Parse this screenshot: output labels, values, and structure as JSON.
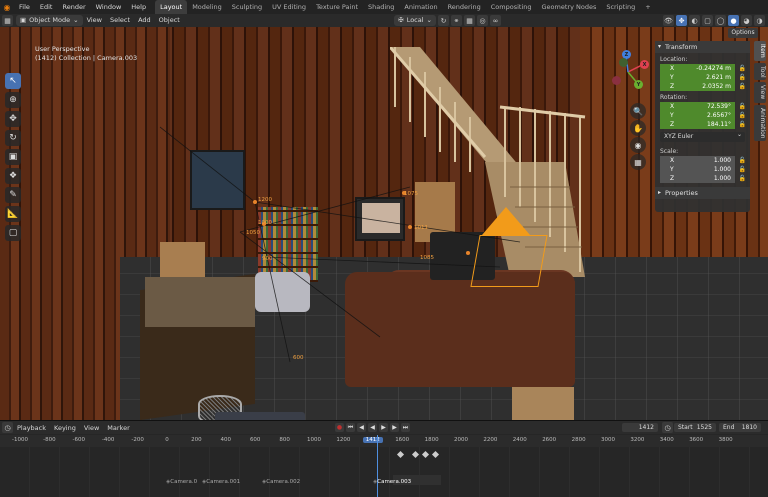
{
  "topbar": {
    "menus": [
      "File",
      "Edit",
      "Render",
      "Window",
      "Help"
    ],
    "workspaces": [
      "Layout",
      "Modeling",
      "Sculpting",
      "UV Editing",
      "Texture Paint",
      "Shading",
      "Animation",
      "Rendering",
      "Compositing",
      "Geometry Nodes",
      "Scripting"
    ],
    "active_workspace": "Layout",
    "add_tab": "+"
  },
  "viewport_header": {
    "mode": "Object Mode",
    "menus": [
      "View",
      "Select",
      "Add",
      "Object"
    ],
    "transform_orientation": "Local"
  },
  "viewport": {
    "perspective": "User Perspective",
    "collection_info": "(1412) Collection | Camera.003",
    "options_label": "Options",
    "annotations": [
      "1050",
      "1000",
      "900",
      "600",
      "1075",
      "1011",
      "1200",
      "1085"
    ]
  },
  "gizmo": {
    "x": "X",
    "y": "Y",
    "z": "Z"
  },
  "npanel": {
    "transform_title": "Transform",
    "location_label": "Location:",
    "location": [
      {
        "axis": "X",
        "value": "-0.24274 m"
      },
      {
        "axis": "Y",
        "value": "2.621 m"
      },
      {
        "axis": "Z",
        "value": "2.0352 m"
      }
    ],
    "rotation_label": "Rotation:",
    "rotation": [
      {
        "axis": "X",
        "value": "72.539°"
      },
      {
        "axis": "Y",
        "value": "2.6567°"
      },
      {
        "axis": "Z",
        "value": "184.11°"
      }
    ],
    "rotation_mode": "XYZ Euler",
    "scale_label": "Scale:",
    "scale": [
      {
        "axis": "X",
        "value": "1.000"
      },
      {
        "axis": "Y",
        "value": "1.000"
      },
      {
        "axis": "Z",
        "value": "1.000"
      }
    ],
    "properties_title": "Properties"
  },
  "side_tabs": [
    "Item",
    "Tool",
    "View",
    "Animation"
  ],
  "timeline": {
    "menus": [
      "Playback",
      "Keying",
      "View",
      "Marker"
    ],
    "current_frame": "1412",
    "start_label": "Start",
    "start": "1525",
    "end_label": "End",
    "end": "1810",
    "ruler": [
      "-1000",
      "-800",
      "-600",
      "-400",
      "-200",
      "0",
      "200",
      "400",
      "600",
      "800",
      "1000",
      "1200",
      "1412",
      "1600",
      "1800",
      "2000",
      "2200",
      "2400",
      "2600",
      "2800",
      "3000",
      "3200",
      "3400",
      "3600",
      "3800"
    ],
    "markers": [
      "Camera.0",
      "Camera.001",
      "Camera.002",
      "Camera.003"
    ]
  },
  "colors": {
    "accent_blue": "#4772b3",
    "field_green": "#4f8a2c",
    "camera_orange": "#f29b1a"
  }
}
